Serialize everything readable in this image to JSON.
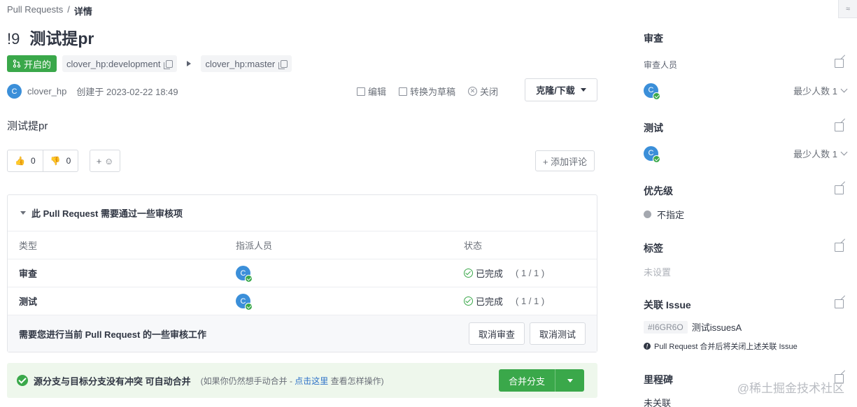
{
  "breadcrumb": {
    "root": "Pull Requests",
    "sep": "/",
    "current": "详情"
  },
  "pr": {
    "number": "!9",
    "title": "测试提pr",
    "status": "开启的",
    "source_branch": "clover_hp:development",
    "target_branch": "clover_hp:master",
    "author": "clover_hp",
    "author_initial": "C",
    "created": "创建于 2023-02-22 18:49",
    "description": "测试提pr"
  },
  "actions": {
    "edit": "编辑",
    "draft": "转换为草稿",
    "close": "关闭",
    "clone": "克隆/下载"
  },
  "reactions": {
    "thumbs_up": {
      "emoji": "👍",
      "count": "0"
    },
    "thumbs_down": {
      "emoji": "👎",
      "count": "0"
    },
    "add": "+ ☺",
    "add_comment": "+ 添加评论"
  },
  "review": {
    "heading": "此 Pull Request 需要通过一些审核项",
    "columns": [
      "类型",
      "指派人员",
      "状态"
    ],
    "rows": [
      {
        "type": "审查",
        "avatar": "C",
        "status": "已完成",
        "fraction": "( 1 / 1 )"
      },
      {
        "type": "测试",
        "avatar": "C",
        "status": "已完成",
        "fraction": "( 1 / 1 )"
      }
    ],
    "footer": "需要您进行当前 Pull Request 的一些审核工作",
    "cancel_review": "取消审查",
    "cancel_test": "取消测试"
  },
  "merge": {
    "message": "源分支与目标分支没有冲突 可自动合并",
    "hint_before": "(如果你仍然想手动合并 - ",
    "hint_link": "点击这里",
    "hint_after": " 查看怎样操作)",
    "button": "合并分支"
  },
  "sidebar": {
    "review_title": "审查",
    "reviewers_label": "审查人员",
    "reviewer_avatar": "C",
    "reviewer_min": "最少人数 1",
    "test_title": "测试",
    "tester_avatar": "C",
    "tester_min": "最少人数 1",
    "priority_title": "优先级",
    "priority_value": "不指定",
    "labels_title": "标签",
    "labels_value": "未设置",
    "issue_title": "关联 Issue",
    "issue_id": "#I6GR6O",
    "issue_name": "测试issuesA",
    "issue_note": "Pull Request 合并后将关闭上述关联 Issue",
    "milestone_title": "里程碑",
    "milestone_value": "未关联"
  },
  "watermark": "@稀土掘金技术社区",
  "corner_glyph": "≈",
  "colors": {
    "green": "#3aa84a",
    "blue": "#3b8fd9",
    "link": "#2e72c8"
  }
}
